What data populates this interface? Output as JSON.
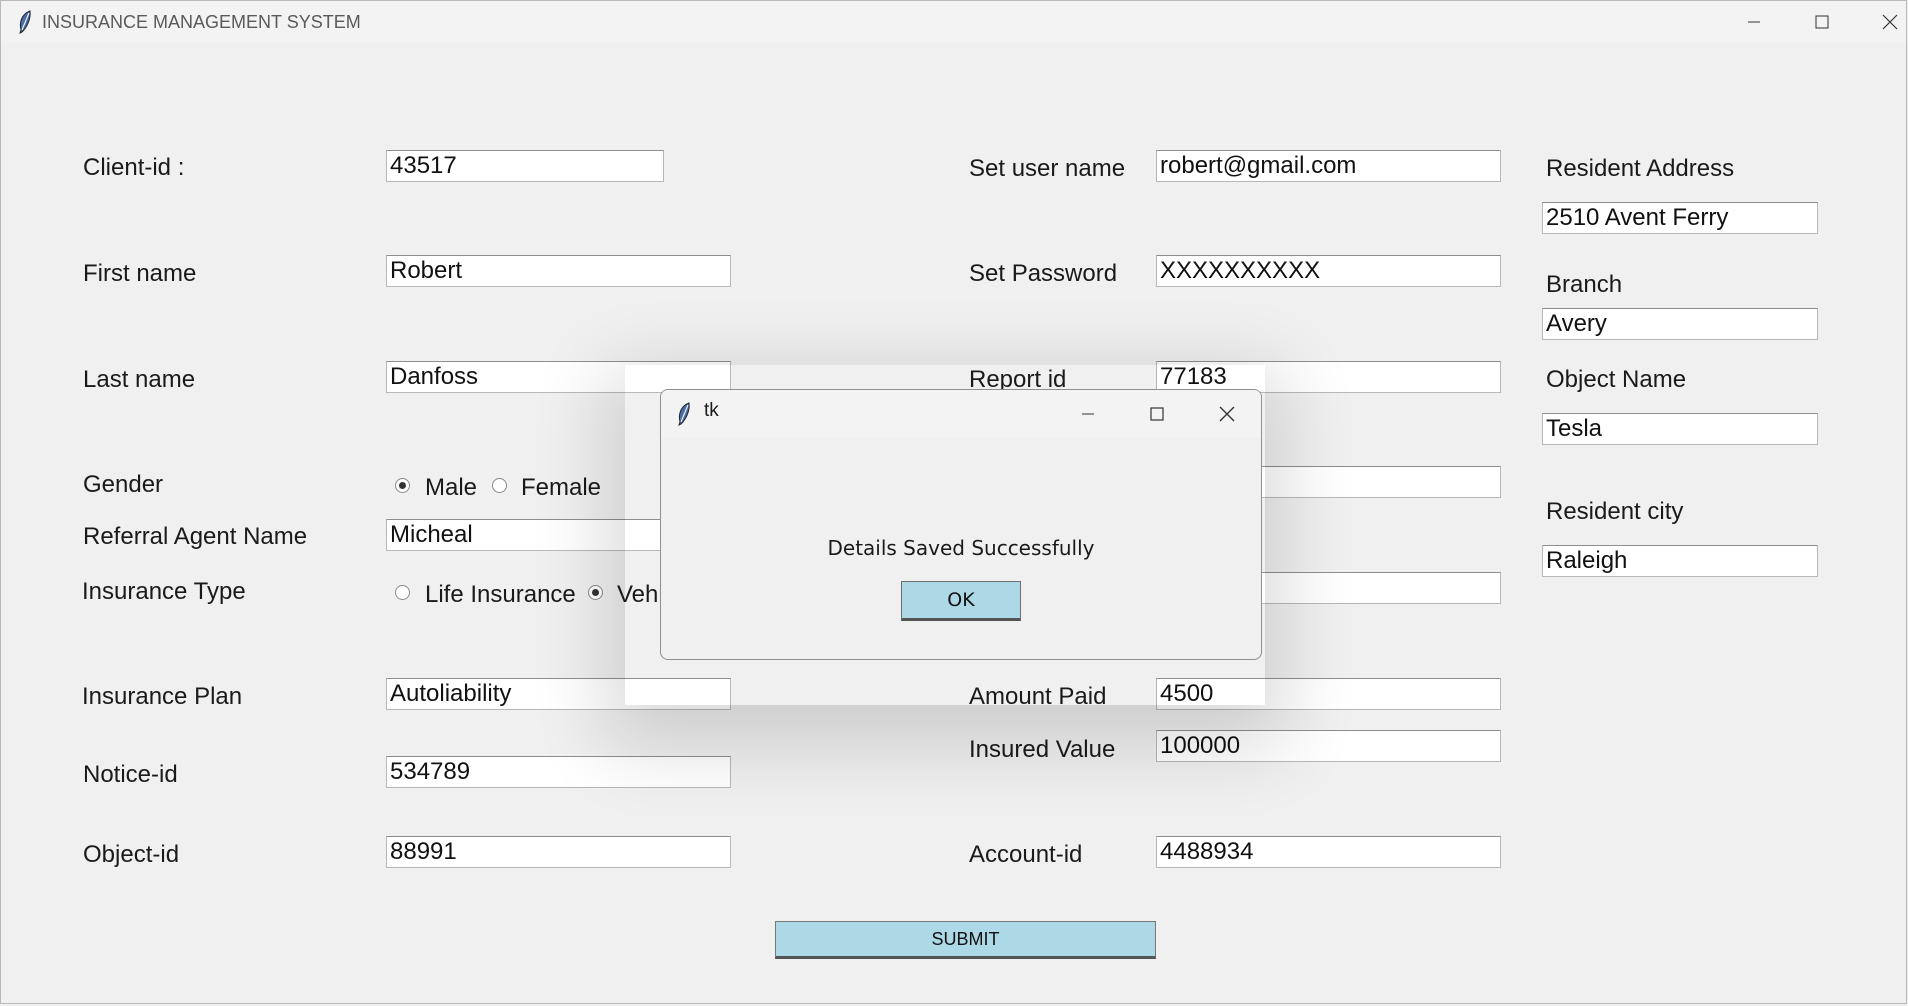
{
  "window": {
    "title": "INSURANCE MANAGEMENT SYSTEM"
  },
  "form": {
    "client_id": {
      "label": "Client-id :",
      "value": "43517"
    },
    "first_name": {
      "label": "First name",
      "value": "Robert"
    },
    "last_name": {
      "label": "Last name",
      "value": "Danfoss"
    },
    "gender": {
      "label": "Gender",
      "options": [
        "Male",
        "Female"
      ],
      "selected": "Male"
    },
    "referral_agent": {
      "label": "Referral Agent Name",
      "value": "Micheal"
    },
    "insurance_type": {
      "label": "Insurance Type",
      "options": [
        "Life Insurance",
        "Vehi"
      ],
      "selected": "Vehi"
    },
    "insurance_plan": {
      "label": "Insurance Plan",
      "value": "Autoliability"
    },
    "notice_id": {
      "label": "Notice-id",
      "value": "534789"
    },
    "object_id": {
      "label": "Object-id",
      "value": "88991"
    },
    "user_name": {
      "label": "Set user name",
      "value": "robert@gmail.com"
    },
    "password": {
      "label": "Set Password",
      "value": "XXXXXXXXXX"
    },
    "report_id": {
      "label": "Report id",
      "value": "77183"
    },
    "hidden_field_1": {
      "value": ""
    },
    "hidden_field_2": {
      "value": ""
    },
    "amount_paid": {
      "label": "Amount Paid",
      "value": "4500"
    },
    "insured_value": {
      "label": "Insured Value",
      "value": "100000"
    },
    "account_id": {
      "label": "Account-id",
      "value": "4488934"
    },
    "resident_address": {
      "label": "Resident Address",
      "value": "2510 Avent Ferry"
    },
    "branch": {
      "label": "Branch",
      "value": "Avery"
    },
    "object_name": {
      "label": "Object Name",
      "value": "Tesla"
    },
    "resident_city": {
      "label": "Resident city",
      "value": "Raleigh"
    },
    "submit_label": "SUBMIT"
  },
  "dialog": {
    "title": "tk",
    "message": "Details Saved Successfully",
    "ok_label": "OK"
  },
  "icons": {
    "app": "feather-icon",
    "minimize": "minimize-icon",
    "maximize": "maximize-icon",
    "close": "close-icon"
  },
  "colors": {
    "button_bg": "#add8e6",
    "window_bg": "#f0f0f0"
  }
}
